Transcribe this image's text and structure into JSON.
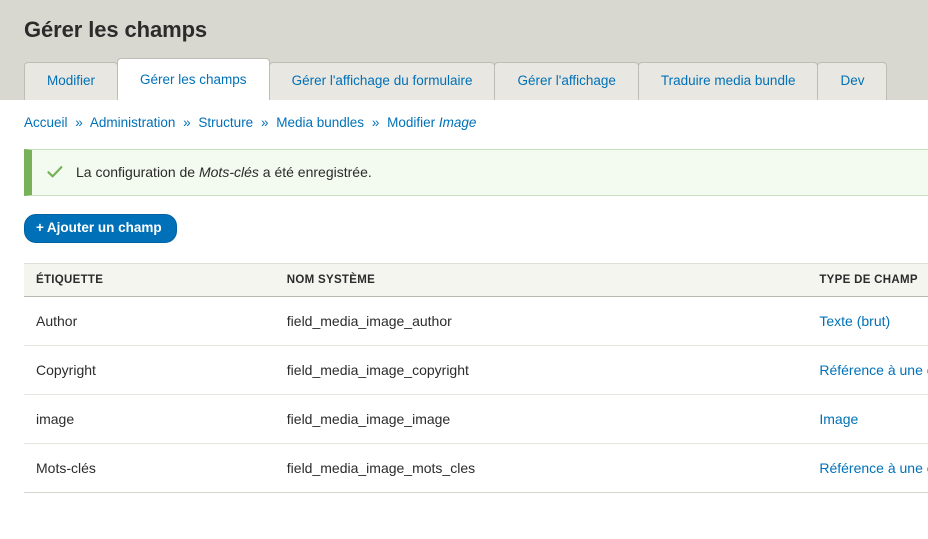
{
  "header": {
    "title": "Gérer les champs"
  },
  "tabs": [
    {
      "label": "Modifier",
      "active": false
    },
    {
      "label": "Gérer les champs",
      "active": true
    },
    {
      "label": "Gérer l'affichage du formulaire",
      "active": false
    },
    {
      "label": "Gérer l'affichage",
      "active": false
    },
    {
      "label": "Traduire media bundle",
      "active": false
    },
    {
      "label": "Dev",
      "active": false
    }
  ],
  "breadcrumb": {
    "separator": "»",
    "items": [
      {
        "label": "Accueil",
        "italic": false
      },
      {
        "label": "Administration",
        "italic": false
      },
      {
        "label": "Structure",
        "italic": false
      },
      {
        "label": "Media bundles",
        "italic": false
      },
      {
        "label": "Modifier",
        "italic": false
      },
      {
        "label": "Image",
        "italic": true
      }
    ]
  },
  "status_message": {
    "icon": "check-icon",
    "text_before": "La configuration de ",
    "emphasis": "Mots-clés",
    "text_after": " a été enregistrée.",
    "border_color": "#77b259",
    "background_color": "#f3faef"
  },
  "action": {
    "plus": "+",
    "add_field_label": "Ajouter un champ",
    "accent_color": "#0071b8"
  },
  "table": {
    "columns": [
      {
        "key": "label",
        "header": "ÉTIQUETTE"
      },
      {
        "key": "machine",
        "header": "NOM SYSTÈME"
      },
      {
        "key": "type",
        "header": "TYPE DE CHAMP"
      }
    ],
    "rows": [
      {
        "label": "Author",
        "machine": "field_media_image_author",
        "type": "Texte (brut)"
      },
      {
        "label": "Copyright",
        "machine": "field_media_image_copyright",
        "type": "Référence à une entité"
      },
      {
        "label": "image",
        "machine": "field_media_image_image",
        "type": "Image"
      },
      {
        "label": "Mots-clés",
        "machine": "field_media_image_mots_cles",
        "type": "Référence à une entité"
      }
    ]
  }
}
